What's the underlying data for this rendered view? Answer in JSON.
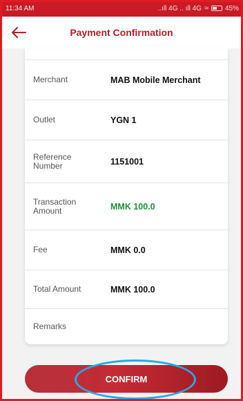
{
  "status_bar": {
    "time": "11:34 AM",
    "network": "..ıll 4G .. ıll 4G",
    "battery": "45%"
  },
  "header": {
    "title": "Payment Confirmation",
    "back_icon": "arrow-left-icon"
  },
  "details": [
    {
      "label": "Merchant",
      "value": "MAB Mobile Merchant"
    },
    {
      "label": "Outlet",
      "value": "YGN 1"
    },
    {
      "label": "Reference Number",
      "value": "1151001"
    },
    {
      "label": "Transaction Amount",
      "value": "MMK 100.0"
    },
    {
      "label": "Fee",
      "value": "MMK 0.0"
    },
    {
      "label": "Total Amount",
      "value": "MMK 100.0"
    },
    {
      "label": "Remarks",
      "value": ""
    }
  ],
  "confirm_button": {
    "label": "CONFIRM"
  },
  "colors": {
    "brand_red": "#c81b25",
    "title_red": "#b71c24",
    "amount_green": "#1e8e3e",
    "highlight_blue": "#2aa8e8"
  }
}
